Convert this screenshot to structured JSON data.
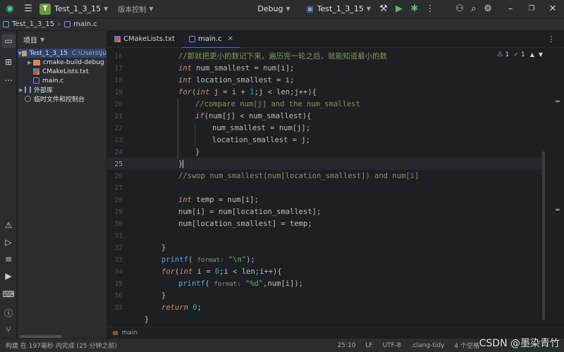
{
  "titlebar": {
    "project_badge": "T",
    "project_name": "Test_1_3_15",
    "vcs_label": "版本控制",
    "build_config": "Debug",
    "run_target": "Test_1_3_15"
  },
  "breadcrumb": {
    "project": "Test_1_3_15",
    "file": "main.c"
  },
  "project_panel": {
    "title": "项目",
    "root_name": "Test_1_3_15",
    "root_path": "C:\\Users\\Ju",
    "items": [
      {
        "label": "cmake-build-debug",
        "kind": "folder"
      },
      {
        "label": "CMakeLists.txt",
        "kind": "cmake"
      },
      {
        "label": "main.c",
        "kind": "c"
      }
    ],
    "external_libs": "外部库",
    "scratches": "临时文件和控制台"
  },
  "tabs": [
    {
      "label": "CMakeLists.txt",
      "active": false
    },
    {
      "label": "main.c",
      "active": true
    }
  ],
  "inspections": {
    "warnings": "1",
    "checks": "1"
  },
  "editor": {
    "current_line": "25",
    "line_numbers": [
      "16",
      "17",
      "18",
      "19",
      "20",
      "21",
      "22",
      "23",
      "24",
      "25",
      "26",
      "27",
      "28",
      "29",
      "30",
      "31",
      "32",
      "33",
      "34",
      "35",
      "36",
      "37"
    ],
    "code": {
      "l16_comment": "//那就把更小的数记下来，遍历完一轮之后，就能知道最小的数",
      "l20_comment": "//compare num[j] and the num_smallest",
      "l26_comment": "//swop num_smallest(num[location_smallest]) and num[i]",
      "hint_format": "format:",
      "str_newline": "\"\\n\"",
      "str_fmt": "\"%d\""
    }
  },
  "editor_breadcrumb": "main",
  "statusbar": {
    "build_msg": "构建 在 197毫秒 内完成 (25 分钟之前)",
    "position": "25:10",
    "line_sep": "LF",
    "encoding": "UTF-8",
    "formatter": ".clang-tidy",
    "indent": "4 个空格"
  },
  "watermark": "CSDN @墨染青竹"
}
